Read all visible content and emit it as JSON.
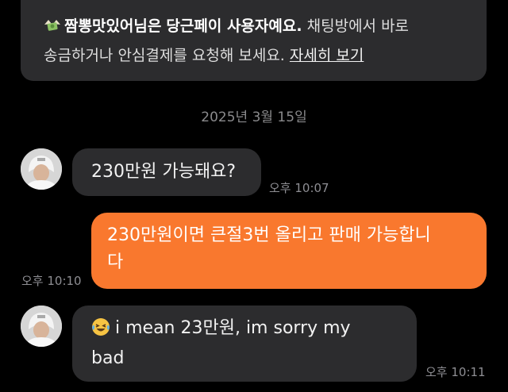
{
  "notice": {
    "icon": "money-wings-emoji",
    "name": "짬뽕맛있어님은",
    "text_bold": "당근페이 사용자예요.",
    "text_line1_rest": "채팅방에서 바로",
    "text_line2": "송금하거나 안심결제를 요청해 보세요.",
    "link": "자세히 보기"
  },
  "date_divider": "2025년 3월 15일",
  "messages": [
    {
      "side": "incoming",
      "text": "230만원 가능돼요?",
      "time": "오후 10:07"
    },
    {
      "side": "outgoing",
      "line1": "230만원이면 큰절3번 올리고 판매 가능합니",
      "line2": "다",
      "time": "오후 10:10"
    },
    {
      "side": "incoming",
      "emoji": "laughing-tears-emoji",
      "line1": "i mean 23만원, im sorry my",
      "line2": "bad",
      "time": "오후 10:11"
    }
  ],
  "colors": {
    "background": "#000000",
    "incoming_bubble": "#2c2c2e",
    "outgoing_bubble": "#f9782e",
    "timestamp": "#8e8e93"
  }
}
